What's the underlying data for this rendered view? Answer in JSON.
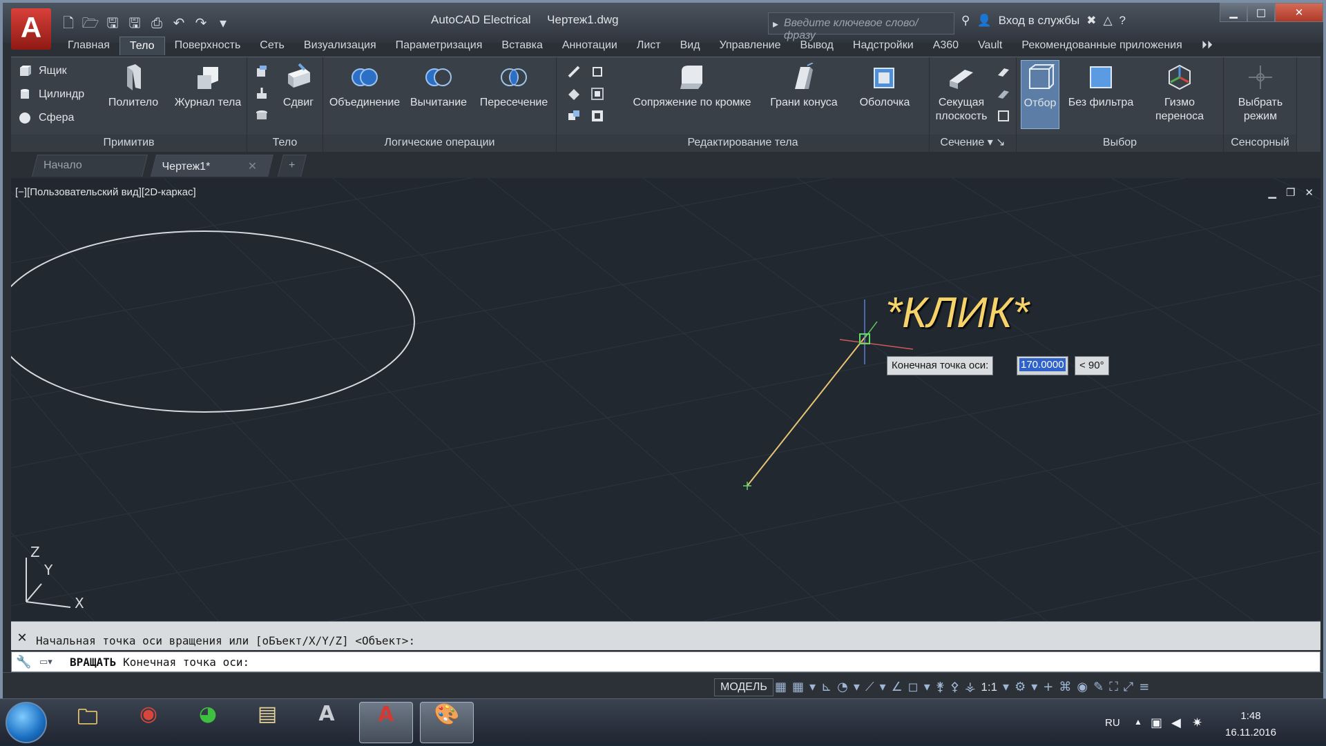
{
  "window": {
    "app_logo": "A",
    "title": "AutoCAD Electrical     Чертеж1.dwg",
    "search_placeholder": "Введите ключевое слово/фразу",
    "signin": "Вход в службы",
    "minimize": "▁",
    "maximize": "□",
    "close": "✕"
  },
  "menu": [
    "Главная",
    "Тело",
    "Поверхность",
    "Сеть",
    "Визуализация",
    "Параметризация",
    "Вставка",
    "Аннотации",
    "Лист",
    "Вид",
    "Управление",
    "Вывод",
    "Надстройки",
    "A360",
    "Vault",
    "Рекомендованные приложения"
  ],
  "menu_active": "Тело",
  "ribbon": {
    "primitives": {
      "label": "Примитив",
      "box": "Ящик",
      "cylinder": "Цилиндр",
      "sphere": "Сфера",
      "polysolid": "Полите­ло",
      "history": "Журнал тела"
    },
    "solid": {
      "label": "Тело",
      "extrude": "Сдвиг"
    },
    "boolean": {
      "label": "Логические операции",
      "union": "Объединение",
      "subtract": "Вычитание",
      "intersect": "Пересечение"
    },
    "edit": {
      "label": "Редактирование тела",
      "fillet": "Сопряжение по кромке",
      "taper": "Грани конуса",
      "shell": "Оболочка"
    },
    "section": {
      "label": "Сечение",
      "plane": "Секущая",
      "plane2": "плоскость"
    },
    "selection": {
      "label": "Выбор",
      "culling": "Отбор",
      "nofilter": "Без фильтра",
      "gizmo": "Гизмо",
      "gizmo2": "переноса"
    },
    "touch": {
      "label": "Сенсорный",
      "mode": "Выбрать",
      "mode2": "режим"
    }
  },
  "tabs": {
    "start": "Начало",
    "drawing": "Чертеж1*",
    "add": "+"
  },
  "viewport": {
    "label": "[−][Пользовательский вид][2D-каркас]",
    "annotation": "*КЛИК*",
    "tooltip_label": "Конечная точка оси:",
    "tooltip_value": "170.0000",
    "tooltip_angle": "< 90°",
    "ucs_x": "X",
    "ucs_y": "Y",
    "ucs_z": "Z"
  },
  "command": {
    "history": "Начальная точка оси вращения или [oБъект/X/Y/Z] <Объект>:",
    "command_name": "ВРАЩАТЬ",
    "prompt": "Конечная точка оси:"
  },
  "status": {
    "model": "МОДЕЛЬ",
    "scale": "1:1"
  },
  "taskbar": {
    "lang": "RU",
    "time": "1:48",
    "date": "16.11.2016"
  },
  "colors": {
    "accent_select": "#2f63c9",
    "axis_line": "#e8c574",
    "annotation": "#f5d26a"
  }
}
